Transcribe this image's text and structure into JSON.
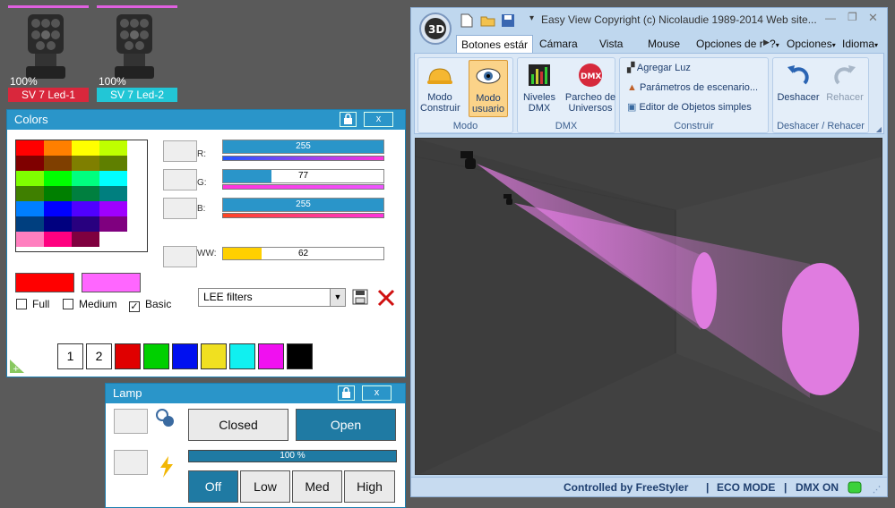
{
  "fixtures": [
    {
      "percent": "100%",
      "name": "SV 7 Led-1",
      "color": "#d9273c"
    },
    {
      "percent": "100%",
      "name": "SV 7 Led-2",
      "color": "#22c6d6"
    }
  ],
  "colors_panel": {
    "title": "Colors",
    "lock_icon": "lock-icon",
    "close_label": "x",
    "channels": [
      {
        "label": "R:",
        "value": "255",
        "level": 1.0
      },
      {
        "label": "G:",
        "value": "77",
        "level": 0.3
      },
      {
        "label": "B:",
        "value": "255",
        "level": 1.0
      },
      {
        "label": "WW:",
        "value": "62",
        "level": 0.24
      }
    ],
    "options": [
      {
        "label": "Full",
        "checked": false
      },
      {
        "label": "Medium",
        "checked": false
      },
      {
        "label": "Basic",
        "checked": true
      }
    ],
    "filter_select": "LEE filters",
    "quick_slots": [
      "1",
      "2"
    ],
    "current_color": "#ff0000",
    "target_color": "#ff66ff"
  },
  "lamp_panel": {
    "title": "Lamp",
    "close_label": "x",
    "closed_label": "Closed",
    "open_label": "Open",
    "percent_label": "100 %",
    "off_label": "Off",
    "low_label": "Low",
    "med_label": "Med",
    "high_label": "High"
  },
  "main_window": {
    "title": "Easy View   Copyright (c) Nicolaudie 1989-2014   Web site...",
    "tabs": [
      "Botones estár",
      "Cámara",
      "Vista",
      "Mouse",
      "Opciones de r"
    ],
    "right_menus": [
      "?",
      "Opciones",
      "Idioma"
    ],
    "groups": {
      "modo": {
        "label": "Modo",
        "buttons": [
          "Modo Construir",
          "Modo usuario"
        ]
      },
      "dmx": {
        "label": "DMX",
        "buttons": [
          "Niveles DMX",
          "Parcheo de Universos"
        ]
      },
      "construir": {
        "label": "Construir",
        "items": [
          "Agregar Luz",
          "Parámetros de escenario...",
          "Editor de Objetos simples"
        ]
      },
      "undo": {
        "label": "Deshacer / Rehacer",
        "buttons": [
          "Deshacer",
          "Rehacer"
        ]
      }
    },
    "status": {
      "controlled": "Controlled by FreeStyler",
      "eco": "ECO MODE",
      "dmx": "DMX ON",
      "sep": "|"
    }
  }
}
